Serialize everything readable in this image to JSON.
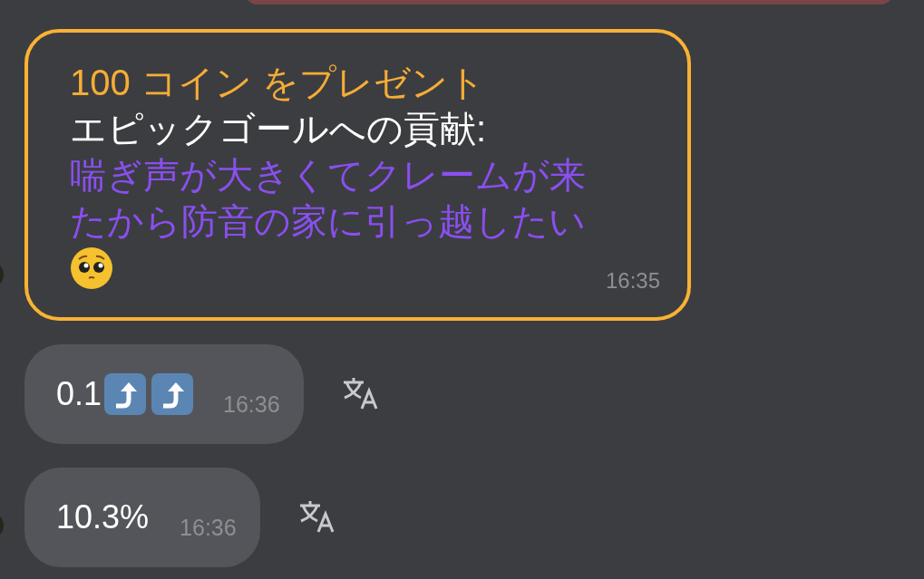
{
  "gift_message": {
    "title": "100 コイン をプレゼント",
    "label": "エピックゴールへの貢献:",
    "message": "喘ぎ声が大きくてクレームが来たから防音の家に引っ越したい",
    "trailing_icon": {
      "kind": "face"
    },
    "time": "16:35",
    "highlighted": true
  },
  "messages": [
    {
      "text": "0.1",
      "trailing_icons": [
        {
          "kind": "arrow"
        },
        {
          "kind": "arrow"
        }
      ],
      "time": "16:36"
    },
    {
      "text": "10.3%",
      "time": "16:36"
    }
  ]
}
